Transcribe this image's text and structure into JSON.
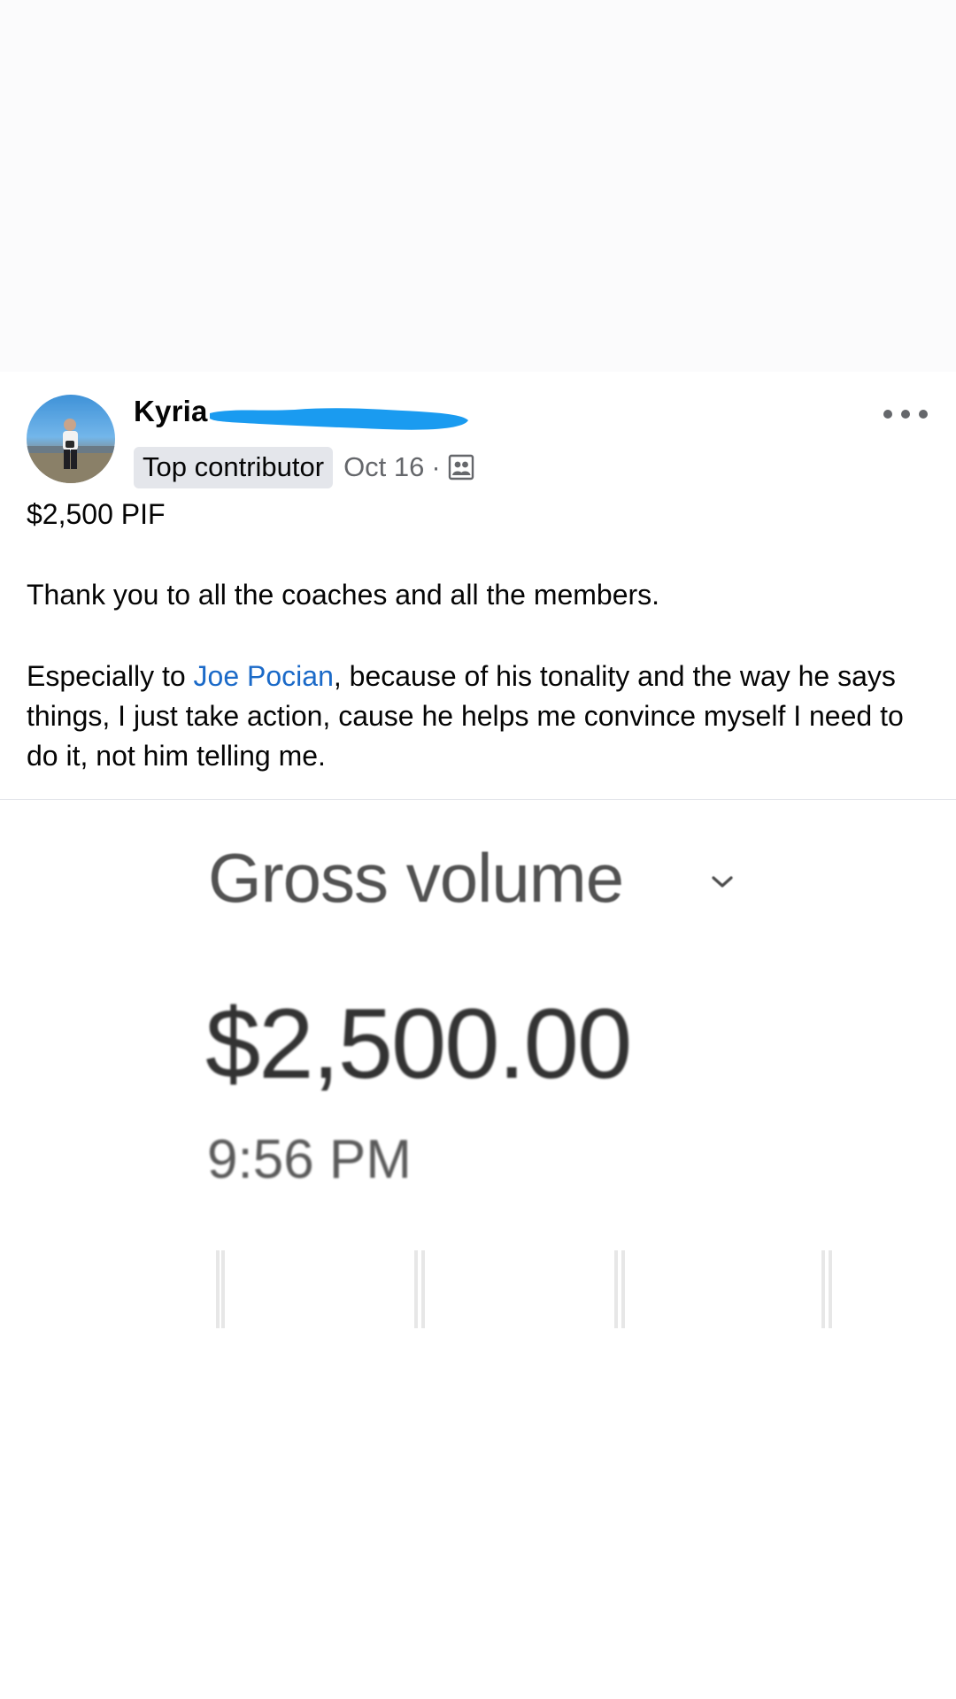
{
  "post": {
    "author": "Kyria",
    "badge": "Top contributor",
    "date": "Oct 16",
    "separator": "·",
    "title": "$2,500 PIF",
    "paragraph1": "Thank you to all the coaches and all the members.",
    "paragraph2_prefix": "Especially to ",
    "mention": "Joe Pocian",
    "paragraph2_suffix": ", because of his tonality and the way he says things, I just take action, cause he helps me convince myself I need to do it, not him telling me.",
    "icons": {
      "more": "more-dots-icon",
      "audience": "group-audience-icon"
    },
    "colors": {
      "mention": "#1b6ac8",
      "redaction": "#1a9bf0"
    }
  },
  "photo": {
    "label": "Gross volume",
    "amount": "$2,500.00",
    "time": "9:56 PM"
  }
}
